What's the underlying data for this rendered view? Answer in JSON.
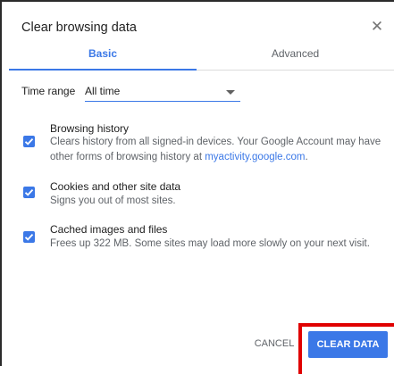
{
  "dialog": {
    "title": "Clear browsing data",
    "close_glyph": "✕"
  },
  "tabs": [
    {
      "label": "Basic",
      "active": true
    },
    {
      "label": "Advanced",
      "active": false
    }
  ],
  "time_range": {
    "label": "Time range",
    "value": "All time"
  },
  "options": [
    {
      "title": "Browsing history",
      "description": "Clears history from all signed-in devices. Your Google Account may have other forms of browsing history at ",
      "link": "myactivity.google.com",
      "suffix": ".",
      "checked": true
    },
    {
      "title": "Cookies and other site data",
      "description": "Signs you out of most sites.",
      "checked": true
    },
    {
      "title": "Cached images and files",
      "description": "Frees up 322 MB. Some sites may load more slowly on your next visit.",
      "checked": true
    }
  ],
  "buttons": {
    "cancel": "CANCEL",
    "clear": "CLEAR DATA"
  },
  "colors": {
    "accent": "#3b78e7",
    "highlight": "#e00000"
  },
  "icons": {
    "close": "close-icon",
    "dropdown": "chevron-down-icon",
    "check": "check-icon"
  }
}
